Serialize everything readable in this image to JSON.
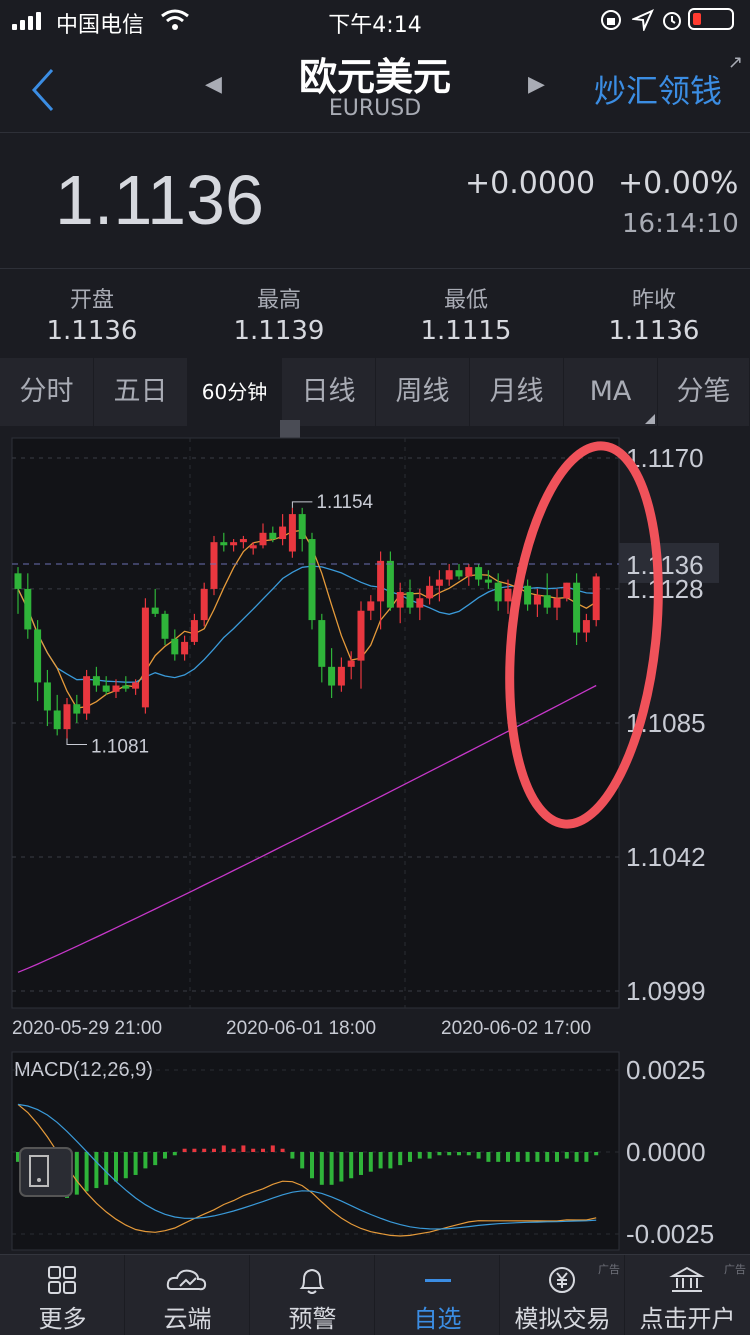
{
  "status_bar": {
    "carrier": "中国电信",
    "time": "下午4:14"
  },
  "header": {
    "title": "欧元美元",
    "symbol": "EURUSD",
    "promo": "炒汇领钱"
  },
  "quote": {
    "price": "1.1136",
    "change": "+0.0000",
    "change_pct": "+0.00%",
    "time": "16:14:10"
  },
  "stats": [
    {
      "label": "开盘",
      "value": "1.1136"
    },
    {
      "label": "最高",
      "value": "1.1139"
    },
    {
      "label": "最低",
      "value": "1.1115"
    },
    {
      "label": "昨收",
      "value": "1.1136"
    }
  ],
  "tabs": [
    "分时",
    "五日",
    "60分钟",
    "日线",
    "周线",
    "月线",
    "MA",
    "分笔"
  ],
  "active_tab": "60分钟",
  "colors": {
    "up": "#e8373f",
    "down": "#2fb43a",
    "ma_short": "#e59a3a",
    "ma_mid": "#3a9ad9",
    "ma_long": "#c637c9",
    "annotation": "#f0525a",
    "accent": "#3b8de3"
  },
  "chart_data": [
    {
      "type": "candlestick",
      "interval": "60分钟",
      "y_ticks": [
        "1.1170",
        "1.1128",
        "1.1085",
        "1.1042",
        "1.0999"
      ],
      "current_price_label": "1.1136",
      "ylim": [
        1.0999,
        1.117
      ],
      "x_labels": [
        "2020-05-29 21:00",
        "2020-06-01 18:00",
        "2020-06-02 17:00"
      ],
      "high_marker": "1.1154",
      "low_marker": "1.1081",
      "ohlc": [
        [
          1.1133,
          1.1135,
          1.112,
          1.1128
        ],
        [
          1.1128,
          1.1133,
          1.1112,
          1.1115
        ],
        [
          1.1115,
          1.1118,
          1.1092,
          1.1098
        ],
        [
          1.1098,
          1.1102,
          1.1084,
          1.1089
        ],
        [
          1.1089,
          1.1094,
          1.1081,
          1.1083
        ],
        [
          1.1083,
          1.1093,
          1.108,
          1.1091
        ],
        [
          1.1091,
          1.1094,
          1.1085,
          1.1088
        ],
        [
          1.1088,
          1.1102,
          1.1086,
          1.11
        ],
        [
          1.11,
          1.1103,
          1.1095,
          1.1097
        ],
        [
          1.1097,
          1.11,
          1.1094,
          1.1095
        ],
        [
          1.1095,
          1.1099,
          1.1093,
          1.1097
        ],
        [
          1.1097,
          1.11,
          1.1095,
          1.1096
        ],
        [
          1.1096,
          1.1099,
          1.1094,
          1.1098
        ],
        [
          1.109,
          1.1125,
          1.1088,
          1.1122
        ],
        [
          1.1122,
          1.1128,
          1.1119,
          1.112
        ],
        [
          1.112,
          1.1121,
          1.111,
          1.1112
        ],
        [
          1.1112,
          1.1115,
          1.1105,
          1.1107
        ],
        [
          1.1107,
          1.1113,
          1.1105,
          1.1111
        ],
        [
          1.1111,
          1.112,
          1.111,
          1.1118
        ],
        [
          1.1118,
          1.113,
          1.1116,
          1.1128
        ],
        [
          1.1128,
          1.1145,
          1.1126,
          1.1143
        ],
        [
          1.1143,
          1.1146,
          1.114,
          1.1142
        ],
        [
          1.1142,
          1.1144,
          1.114,
          1.1143
        ],
        [
          1.1143,
          1.1145,
          1.1141,
          1.1144
        ],
        [
          1.1141,
          1.1143,
          1.1139,
          1.1142
        ],
        [
          1.1142,
          1.1149,
          1.1141,
          1.1146
        ],
        [
          1.1146,
          1.1148,
          1.1143,
          1.1144
        ],
        [
          1.1144,
          1.1152,
          1.1142,
          1.1148
        ],
        [
          1.114,
          1.1154,
          1.1138,
          1.1152
        ],
        [
          1.1152,
          1.1154,
          1.114,
          1.1144
        ],
        [
          1.1144,
          1.1146,
          1.1115,
          1.1118
        ],
        [
          1.1118,
          1.112,
          1.1098,
          1.1103
        ],
        [
          1.1103,
          1.1109,
          1.1093,
          1.1097
        ],
        [
          1.1097,
          1.1106,
          1.1095,
          1.1103
        ],
        [
          1.1103,
          1.1108,
          1.1099,
          1.1105
        ],
        [
          1.1105,
          1.1124,
          1.1096,
          1.1121
        ],
        [
          1.1121,
          1.1126,
          1.1118,
          1.1124
        ],
        [
          1.1124,
          1.114,
          1.1115,
          1.1137
        ],
        [
          1.1137,
          1.114,
          1.1121,
          1.1122
        ],
        [
          1.1122,
          1.113,
          1.1117,
          1.1127
        ],
        [
          1.1127,
          1.1131,
          1.112,
          1.1122
        ],
        [
          1.1122,
          1.1128,
          1.1118,
          1.1125
        ],
        [
          1.1125,
          1.1132,
          1.1123,
          1.1129
        ],
        [
          1.1129,
          1.1134,
          1.1124,
          1.1131
        ],
        [
          1.1131,
          1.1136,
          1.1129,
          1.1134
        ],
        [
          1.1134,
          1.1136,
          1.1131,
          1.1132
        ],
        [
          1.1132,
          1.1136,
          1.1129,
          1.1135
        ],
        [
          1.1135,
          1.1136,
          1.1129,
          1.1131
        ],
        [
          1.1131,
          1.1134,
          1.1128,
          1.113
        ],
        [
          1.113,
          1.1133,
          1.1121,
          1.1124
        ],
        [
          1.1124,
          1.1131,
          1.112,
          1.1128
        ],
        [
          1.1128,
          1.1135,
          1.1127,
          1.1129
        ],
        [
          1.1129,
          1.1131,
          1.1121,
          1.1123
        ],
        [
          1.1123,
          1.1128,
          1.1119,
          1.1126
        ],
        [
          1.1126,
          1.1133,
          1.112,
          1.1122
        ],
        [
          1.1122,
          1.1128,
          1.1118,
          1.1125
        ],
        [
          1.1125,
          1.113,
          1.1124,
          1.113
        ],
        [
          1.113,
          1.1133,
          1.111,
          1.1114
        ],
        [
          1.1114,
          1.112,
          1.1111,
          1.1118
        ],
        [
          1.1118,
          1.1133,
          1.1116,
          1.1132
        ]
      ]
    },
    {
      "type": "macd",
      "title": "MACD(12,26,9)",
      "y_ticks": [
        "0.0025",
        "0.0000",
        "-0.0025"
      ],
      "ylim": [
        -0.0025,
        0.0025
      ],
      "histogram": [
        -0.0003,
        -0.0006,
        -0.0009,
        -0.0011,
        -0.0013,
        -0.0014,
        -0.0013,
        -0.0012,
        -0.0011,
        -0.001,
        -0.0009,
        -0.0008,
        -0.0007,
        -0.0005,
        -0.0004,
        -0.0002,
        -0.0001,
        0.0001,
        0.0001,
        0.0001,
        0.0001,
        0.0002,
        0.0001,
        0.0002,
        0.0001,
        0.0001,
        0.0002,
        0.0001,
        -0.0002,
        -0.0005,
        -0.0008,
        -0.001,
        -0.001,
        -0.0009,
        -0.0008,
        -0.0007,
        -0.0006,
        -0.0005,
        -0.0005,
        -0.0004,
        -0.0003,
        -0.0002,
        -0.0002,
        -0.0001,
        -0.0001,
        -0.0001,
        -0.0001,
        -0.0002,
        -0.0003,
        -0.0003,
        -0.0003,
        -0.0003,
        -0.0003,
        -0.0003,
        -0.0003,
        -0.0003,
        -0.0002,
        -0.0003,
        -0.0003,
        -0.0001
      ]
    }
  ],
  "bottom_nav": [
    {
      "label": "更多",
      "icon": "grid-icon",
      "ad": false
    },
    {
      "label": "云端",
      "icon": "cloud-icon",
      "ad": false
    },
    {
      "label": "预警",
      "icon": "bell-icon",
      "ad": false
    },
    {
      "label": "自选",
      "icon": "dash-icon",
      "ad": false,
      "active": true
    },
    {
      "label": "模拟交易",
      "icon": "yen-coin-icon",
      "ad": true
    },
    {
      "label": "点击开户",
      "icon": "bank-icon",
      "ad": true
    }
  ],
  "ad_label": "广告"
}
